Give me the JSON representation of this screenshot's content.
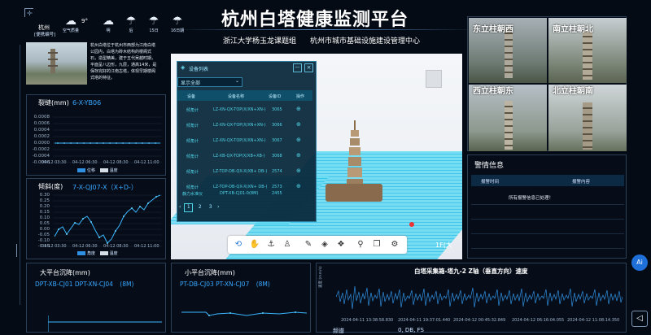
{
  "header": {
    "title": "杭州白塔健康监测平台",
    "subtitle_left": "浙江大学杨玉龙课题组",
    "subtitle_right": "杭州市城市基础设施建设管理中心"
  },
  "weather": {
    "location": "杭州",
    "location_sub": "[便携编号]",
    "items": [
      {
        "icon": "cloud-icon",
        "label": "空气质量",
        "value": "9°"
      },
      {
        "icon": "cloud-icon",
        "label": "明"
      },
      {
        "icon": "rain-icon",
        "label": "后"
      },
      {
        "icon": "rain-icon",
        "label": "15日"
      },
      {
        "icon": "rain-icon",
        "label": "16日期"
      }
    ]
  },
  "intro": {
    "text": "杭州白塔位于杭州市西部为江南白塔公园内，白塔为砖木结构的楼阁式石，造型精美，建于五代吴越时期，平面呈八边形，九层，通高14米，是保存完好的江南古塔，体现早期楼阁式塔的特征。"
  },
  "crack_chart": {
    "title": "裂缝(mm)",
    "id": "6-X-YB06",
    "yticks": [
      "0.0008",
      "0.0006",
      "0.0004",
      "0.0002",
      "0.0000",
      "-0.0002",
      "-0.0004",
      "-0.0006",
      "-0.0008"
    ],
    "xticks": [
      "04-12 03:30",
      "04-12 06:30",
      "04-12 08:30",
      "04-12 11:00"
    ],
    "legend": [
      "位移",
      "温度"
    ]
  },
  "tilt_chart": {
    "title": "倾斜(度)",
    "id": "7-X-QJ07-X（X+D-）",
    "yticks": [
      "0.30",
      "0.25",
      "0.20",
      "0.15",
      "0.10",
      "0.05",
      "0.00",
      "-0.05",
      "-0.10",
      "-0.15"
    ],
    "xticks": [
      "04-12 03:30",
      "04-12 06:30",
      "04-12 08:30",
      "04-12 11:00"
    ],
    "legend": [
      "角度",
      "温度"
    ]
  },
  "device_list": {
    "title": "设备列表",
    "filter": "显示全部",
    "columns": [
      "设备",
      "设备名称",
      "设备ID",
      "操作"
    ],
    "rows": [
      [
        "倾角计",
        "LZ-XN-QX-TOP(X/XN+XN-)",
        "3065"
      ],
      [
        "倾角计",
        "LZ-XN-QX-TOP(X/XN+XN-)",
        "3066"
      ],
      [
        "倾角计",
        "LZ-XN-QX-TOP(X/XN+XN-)",
        "3067"
      ],
      [
        "倾角计",
        "LZ-XB-QX-TOP(X/XB+XB-)",
        "3068"
      ],
      [
        "倾角计",
        "LZ-TOP-DB-QX-X(XB+ DB-)",
        "2574"
      ],
      [
        "倾角计",
        "LZ-TOP-DB-QX-X(XN+ DB-)",
        "2573"
      ],
      [
        "静力水准仪",
        "DPT-XB-CJ01-0(8M)",
        "2455"
      ]
    ],
    "pages": [
      "1",
      "2",
      "3"
    ]
  },
  "cameras": {
    "labels": [
      "东立柱朝西",
      "南立柱朝北",
      "西立柱朝东",
      "北立柱朝南"
    ]
  },
  "alarm": {
    "title": "警情信息",
    "columns": [
      "报警时间",
      "报警内容"
    ],
    "empty_text": "所有报警信息已处理！"
  },
  "settle_big": {
    "title": "大平台沉降(mm)",
    "ids": [
      "DPT-XB-CJ01",
      "DPT-XN-CJ04",
      "(8M)"
    ]
  },
  "settle_small": {
    "title": "小平台沉降(mm)",
    "ids": [
      "PT-DB-CJ03",
      "PT-XN-CJ07",
      "(8M)"
    ]
  },
  "velocity_chart": {
    "title": "白塔采集箱-塔九-2 Z轴（垂直方向）速度",
    "ylabel": "速度 (mm/s)",
    "xticks": [
      "2024-04-11 13:38:58.830",
      "2024-04-11 19:37:01.440",
      "2024-04-12 00:45:32.849",
      "2024-04-12 06:16:04.055",
      "2024-04-12 11:08:14.350"
    ],
    "bottom_left": "频谱",
    "bottom_mid": "0, DB, FS"
  },
  "scene": {
    "float_label": "1F(大",
    "toolbar_icons": [
      "orbit-icon",
      "hand-icon",
      "anchor-icon",
      "person-icon",
      "measure-icon",
      "layer-icon",
      "explode-icon",
      "tree-icon",
      "gear-icon"
    ]
  },
  "side_buttons": {
    "ai_label": "Ai",
    "collapse_label": "◁"
  }
}
